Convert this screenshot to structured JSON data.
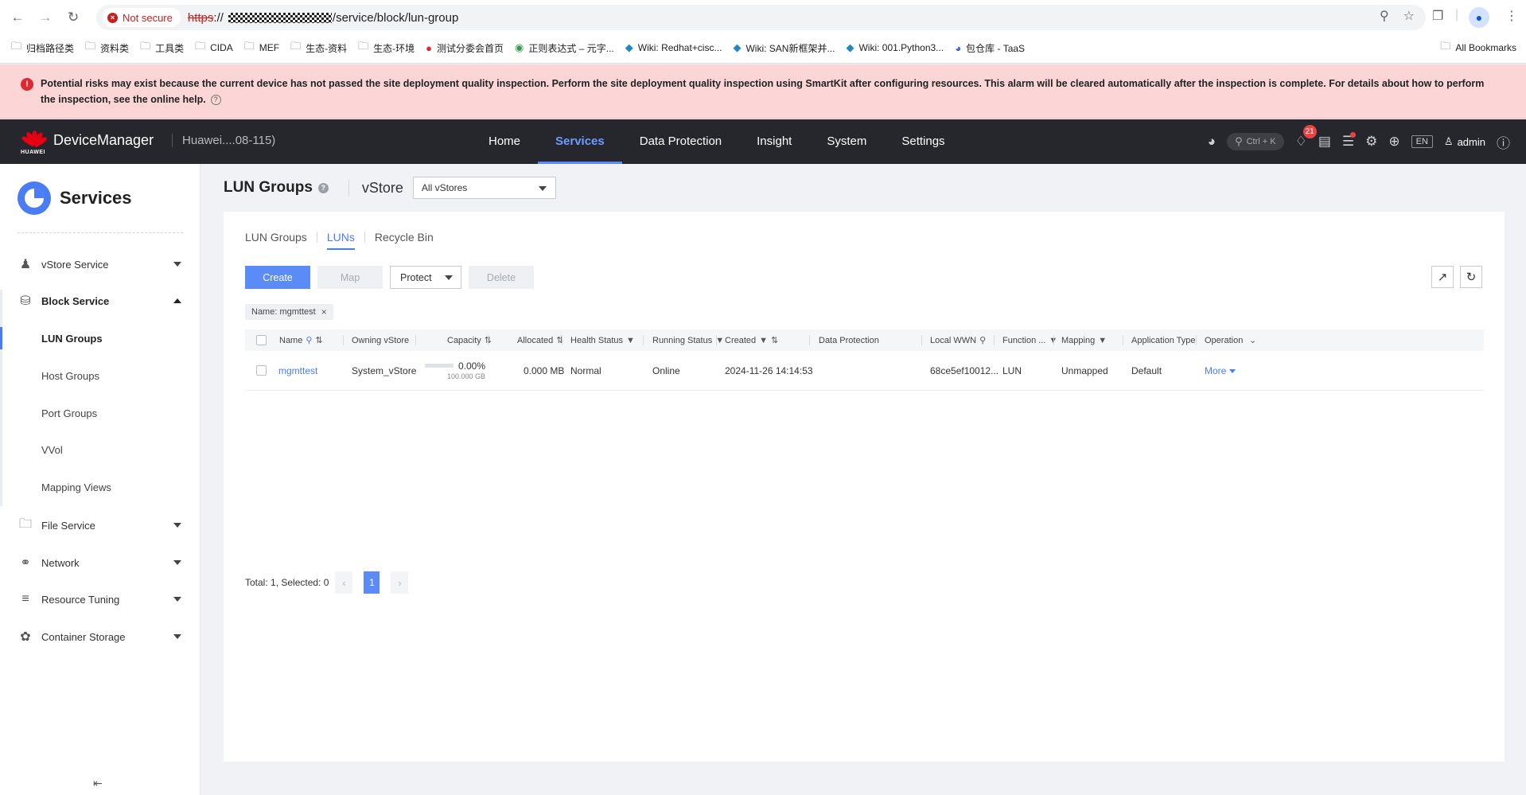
{
  "browser": {
    "not_secure": "Not secure",
    "url_scheme": "https",
    "url_sep": "://",
    "url_path": "/service/block/lun-group",
    "bookmarks": [
      "归档路径类",
      "资料类",
      "工具类",
      "CIDA",
      "MEF",
      "生态-资料",
      "生态-环境",
      "测试分委会首页",
      "正则表达式 – 元字...",
      "Wiki: Redhat+cisc...",
      "Wiki: SAN新框架并...",
      "Wiki: 001.Python3...",
      "包仓库 - TaaS"
    ],
    "all_bookmarks": "All Bookmarks"
  },
  "alert": {
    "message": "Potential risks may exist because the current device has not passed the site deployment quality inspection. Perform the site deployment quality inspection using SmartKit after configuring resources. This alarm will be cleared automatically after the inspection is complete. For details about how to perform the inspection, see the online help."
  },
  "header": {
    "logo_text": "HUAWEI",
    "app_name": "DeviceManager",
    "device_name": "Huawei....08-115)",
    "nav": [
      "Home",
      "Services",
      "Data Protection",
      "Insight",
      "System",
      "Settings"
    ],
    "active_nav": "Services",
    "search_hint": "Ctrl + K",
    "notification_count": "21",
    "lang": "EN",
    "user": "admin"
  },
  "sidebar": {
    "title": "Services",
    "items": [
      {
        "label": "vStore Service",
        "icon": "users-icon"
      },
      {
        "label": "Block Service",
        "icon": "database-icon"
      },
      {
        "label": "File Service",
        "icon": "folder-icon"
      },
      {
        "label": "Network",
        "icon": "network-icon"
      },
      {
        "label": "Resource Tuning",
        "icon": "layers-icon"
      },
      {
        "label": "Container Storage",
        "icon": "container-icon"
      }
    ],
    "block_sub": [
      "LUN Groups",
      "Host Groups",
      "Port Groups",
      "VVol",
      "Mapping Views"
    ],
    "active_sub": "LUN Groups"
  },
  "page": {
    "title": "LUN Groups",
    "vstore_label": "vStore",
    "vstore_value": "All vStores"
  },
  "tabs": [
    "LUN Groups",
    "LUNs",
    "Recycle Bin"
  ],
  "active_tab": "LUNs",
  "toolbar": {
    "create": "Create",
    "map": "Map",
    "protect": "Protect",
    "delete": "Delete"
  },
  "filter_tag": "Name: mgmttest",
  "table": {
    "columns": [
      "Name",
      "Owning vStore",
      "Capacity",
      "Allocated",
      "Health Status",
      "Running Status",
      "Created",
      "Data Protection",
      "Local WWN",
      "Function ...",
      "Mapping",
      "Application Type",
      "Operation"
    ],
    "rows": [
      {
        "name": "mgmttest",
        "owning_vstore": "System_vStore",
        "capacity_pct": "0.00%",
        "capacity_total": "100.000 GB",
        "capacity_used_fraction": 0.0,
        "allocated": "0.000 MB",
        "health": "Normal",
        "running": "Online",
        "created": "2024-11-26 14:14:53",
        "data_protection": "",
        "local_wwn": "68ce5ef10012...",
        "function": "LUN",
        "mapping": "Unmapped",
        "app_type": "Default",
        "operation": "More"
      }
    ]
  },
  "pager": {
    "summary": "Total: 1, Selected: 0",
    "page": "1"
  },
  "colors": {
    "accent": "#4a7cf6",
    "header_bg": "#26272c",
    "alert_bg": "#fcd6d6"
  }
}
